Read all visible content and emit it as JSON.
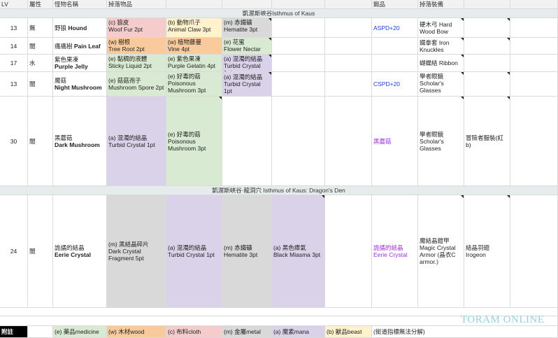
{
  "headers": {
    "lv": "LV",
    "attr": "屬性",
    "name": "怪物名稱",
    "drops": "掉落物品",
    "smith": "鍛品",
    "equip": "掉落裝備"
  },
  "sections": [
    "凱渥斯峽谷Isthmus of Kaus",
    "凱渥斯峽谷·龍洞穴 Isthmus of Kaus: Dragon's Den"
  ],
  "rows": [
    {
      "lv": "13",
      "attr": "無",
      "name_zh": "野狼",
      "name_en": "Hound",
      "drops": [
        {
          "line1": "(c) 狼皮",
          "line2": "Woof Fur 2pt",
          "color": "pink"
        },
        {
          "line1": "(b) 動物爪子",
          "line2": "Animal Claw 3pt",
          "color": "yellow"
        },
        {
          "line1": "(m) 赤鐵礦",
          "line2": "Hematite 3pt",
          "color": "gray"
        }
      ],
      "smith": "ASPD+20",
      "smith_color": "blue",
      "equip": "硬木弓 Hard\nWood Bow",
      "equip2": ""
    },
    {
      "lv": "14",
      "attr": "闇",
      "name_zh": "痛痛樹",
      "name_en": "Pain Leaf",
      "drops": [
        {
          "line1": "(w) 樹根",
          "line2": "Tree Root 2pt",
          "color": "orange"
        },
        {
          "line1": "(w) 植物藤蔓",
          "line2": "Vine 4pt",
          "color": "orange"
        },
        {
          "line1": "(e) 花蜜",
          "line2": "Flower Nectar 3pt",
          "color": "green"
        }
      ],
      "smith": "",
      "smith_color": "",
      "equip": "鐵拳套 Iron\nKnuckles",
      "equip2": ""
    },
    {
      "lv": "17",
      "attr": "水",
      "name_zh": "紫色果凍",
      "name_en": "Purple Jelly",
      "drops": [
        {
          "line1": "(e) 黏稠的液體",
          "line2": "Sticky Liquid 2pt",
          "color": "green"
        },
        {
          "line1": "(e) 紫色果凍",
          "line2": "Purple Gelatin 4pt",
          "color": "green"
        },
        {
          "line1": "(a) 混濁的結晶",
          "line2": "Turbid Crystal 1pt",
          "color": "purple"
        }
      ],
      "smith": "",
      "smith_color": "",
      "equip": "蝴蝶結 Ribbon",
      "equip2": ""
    },
    {
      "lv": "13",
      "attr": "闇",
      "name_zh": "魔菇",
      "name_en": "Night Mushroom",
      "drops": [
        {
          "line1": "(e) 菇菇孢子",
          "line2": "Mushroom Spore 2pt",
          "color": "green"
        },
        {
          "line1": "(e) 好毒的菇",
          "line2": "Poisonous\nMushroom 3pt",
          "color": "green"
        },
        {
          "line1": "(a) 混濁的結晶",
          "line2": "Turbid Crystal 1pt",
          "color": "purple"
        }
      ],
      "smith": "CSPD+20",
      "smith_color": "blue",
      "equip": "學者眼鏡\nScholar's\nGlasses",
      "equip2": ""
    },
    {
      "lv": "30",
      "attr": "闇",
      "name_zh": "黑蘑菇",
      "name_en": "Dark Mushroom",
      "drops": [
        {
          "line1": "(a) 混濁的結晶",
          "line2": "Turbid Crystal 1pt",
          "color": "purple"
        },
        {
          "line1": "(e) 好毒的菇",
          "line2": "Poisonous\nMushroom 3pt",
          "color": "green"
        }
      ],
      "smith": "黑蘑菇",
      "smith_color": "purple",
      "equip": "學者眼鏡\nScholar's\nGlasses",
      "equip2": "冒險者服裝(紅b)"
    },
    {
      "lv": "24",
      "attr": "闇",
      "name_zh": "詭譎的結晶",
      "name_en": "Eerie Crystal",
      "drops": [
        {
          "line1": "(m) 黑結晶碎片",
          "line2": "Dark Crystal\nFragment 5pt",
          "color": "gray"
        },
        {
          "line1": "(a) 混濁的結晶",
          "line2": "Turbid Crystal 1pt",
          "color": "purple"
        },
        {
          "line1": "(m) 赤鐵礦",
          "line2": "Hematite 3pt",
          "color": "gray"
        },
        {
          "line1": "(a) 黑色瘴氣",
          "line2": "Black Miasma 3pt",
          "color": "purple"
        }
      ],
      "smith": "詭譎的結晶\nEerie Crystal",
      "smith_color": "purple",
      "equip": "魔結晶鎧甲\nMagic Crystal\nArmor (晶衣C\narmor.)",
      "equip2": "結晶羽翅\nIrogeon"
    }
  ],
  "legend": {
    "label": "附註",
    "items": [
      {
        "text": "(e) 藥品medicine",
        "color": "green"
      },
      {
        "text": "(w) 木材wood",
        "color": "orange"
      },
      {
        "text": "(c) 布料cloth",
        "color": "pink"
      },
      {
        "text": "(m) 金屬metal",
        "color": "gray"
      },
      {
        "text": "(a) 魔素mana",
        "color": "purple"
      },
      {
        "text": "(b) 獸品beast",
        "color": "yellow"
      }
    ],
    "note": "(銜道指標無法分解)"
  },
  "brand": "TORAM ONLINE"
}
